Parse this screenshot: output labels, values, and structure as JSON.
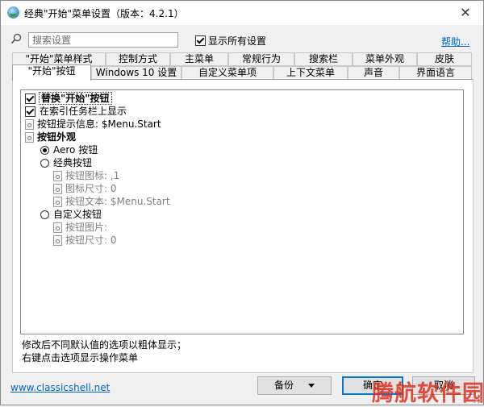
{
  "window": {
    "title": "经典\"开始\"菜单设置（版本：4.2.1）",
    "close": "✕"
  },
  "toolbar": {
    "search_placeholder": "搜索设置",
    "show_all_label": "显示所有设置",
    "show_all_checked": true,
    "help_label": "帮助..."
  },
  "tabs_row1": [
    "\"开始\"菜单样式",
    "控制方式",
    "主菜单",
    "常规行为",
    "搜索栏",
    "菜单外观",
    "皮肤"
  ],
  "tabs_row2": [
    "\"开始\"按钮",
    "Windows 10 设置",
    "自定义菜单项",
    "上下文菜单",
    "声音",
    "界面语言"
  ],
  "active_tab": "\"开始\"按钮",
  "settings": {
    "replace_button": "替换\"开始\"按钮",
    "show_on_taskbar": "在索引任务栏上显示",
    "tooltip": "按钮提示信息: $Menu.Start",
    "appearance": "按钮外观",
    "aero": "Aero 按钮",
    "classic": "经典按钮",
    "classic_icon": "按钮图标: ,1",
    "classic_icon_size": "图标尺寸: 0",
    "classic_text": "按钮文本: $Menu.Start",
    "custom": "自定义按钮",
    "custom_image": "按钮图片:",
    "custom_size": "按钮尺寸: 0"
  },
  "notes": {
    "line1": "修改后不同默认值的选项以粗体显示；",
    "line2": "右键点击选项显示操作菜单"
  },
  "footer": {
    "site_link": "www.classicshell.net",
    "backup_label": "备份",
    "ok_label": "确定",
    "cancel_label": "取消"
  },
  "watermark": "腾航软件园",
  "colors": {
    "link": "#0066cc",
    "accent": "#0078d7",
    "watermark": "#e0301e"
  }
}
